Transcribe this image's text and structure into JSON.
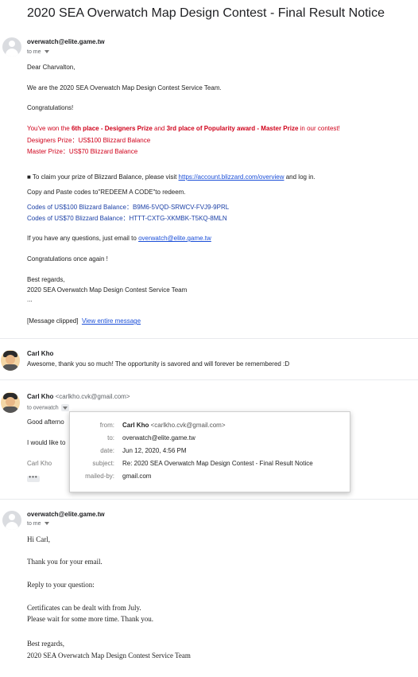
{
  "subject": "2020 SEA Overwatch Map Design Contest - Final Result Notice",
  "msg1": {
    "sender": "overwatch@elite.game.tw",
    "to": "to me",
    "greeting": "Dear Charvalton,",
    "intro": "We are the 2020 SEA Overwatch Map Design Contest Service Team.",
    "congrats": "Congratulations!",
    "won_pre": "You've won the ",
    "won_place1": "6th place - Designers Prize",
    "won_and": " and ",
    "won_place2": "3rd place of Popularity award - Master Prize",
    "won_post": " in our contest!",
    "prize1": "Designers Prize：US$100 Blizzard Balance",
    "prize2": "Master Prize：US$70 Blizzard Balance",
    "claim_pre": "■ To claim your prize of Blizzard Balance, please visit ",
    "claim_link": "https://account.blizzard.com/overview",
    "claim_post": " and log in.",
    "copy": "Copy and Paste codes to\"REDEEM A CODE\"to redeem.",
    "code1": "Codes of US$100 Blizzard Balance：B9M6-5VQD-SRWCV-FVJ9-9PRL",
    "code2": "Codes of US$70 Blizzard Balance：HTTT-CXTG-XKMBK-T5KQ-8MLN",
    "question_pre": "If you have any questions, just email to ",
    "question_link": "overwatch@elite.game.tw",
    "again": "Congratulations once again !",
    "regards": "Best regards,",
    "team": "2020 SEA Overwatch Map Design Contest Service Team",
    "ellipsis": "...",
    "clipped": "[Message clipped]",
    "view_entire": "View entire message"
  },
  "msg2": {
    "sender": "Carl Kho",
    "snippet": "Awesome, thank you so much! The opportunity is savored and will forever be remembered :D"
  },
  "msg3": {
    "sender": "Carl Kho",
    "addr": "<carlkho.cvk@gmail.com>",
    "to": "to overwatch",
    "line1": "Good afterno",
    "line2": "I would like to",
    "sig": "Carl Kho",
    "dots": "•••"
  },
  "popup": {
    "from_label": "from:",
    "from_name": "Carl Kho",
    "from_addr": "<carlkho.cvk@gmail.com>",
    "to_label": "to:",
    "to_value": "overwatch@elite.game.tw",
    "date_label": "date:",
    "date_value": "Jun 12, 2020, 4:56 PM",
    "subject_label": "subject:",
    "subject_value": "Re: 2020 SEA Overwatch Map Design Contest - Final Result Notice",
    "mailedby_label": "mailed-by:",
    "mailedby_value": "gmail.com"
  },
  "msg4": {
    "sender": "overwatch@elite.game.tw",
    "to": "to me",
    "hi": "Hi Carl,",
    "thanks": "Thank you for your email.",
    "reply": "Reply to your question:",
    "cert": "Certificates can be dealt with from July.",
    "wait": "Please wait for some more time. Thank you.",
    "regards": "Best regards,",
    "team": "2020 SEA Overwatch Map Design Contest Service Team"
  }
}
